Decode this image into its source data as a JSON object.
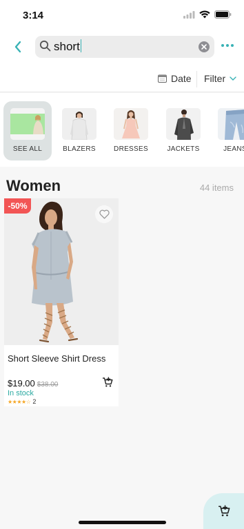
{
  "status": {
    "time": "3:14"
  },
  "search": {
    "query": "short"
  },
  "sort": {
    "date_label": "Date",
    "filter_label": "Filter"
  },
  "categories": [
    {
      "label": "SEE ALL",
      "selected": true
    },
    {
      "label": "BLAZERS"
    },
    {
      "label": "DRESSES"
    },
    {
      "label": "JACKETS"
    },
    {
      "label": "JEANS"
    }
  ],
  "section": {
    "title": "Women",
    "count": "44 items"
  },
  "product": {
    "discount": "-50%",
    "name": "Short Sleeve Shirt Dress",
    "price": "$19.00",
    "old_price": "$38.00",
    "stock": "In stock",
    "stars": "★★★★☆",
    "rating_value": 4.5,
    "review_count": "2"
  },
  "colors": {
    "accent": "#38b2b5",
    "sale": "#f25555",
    "in_stock": "#2aa9a0",
    "star": "#f5a623"
  }
}
